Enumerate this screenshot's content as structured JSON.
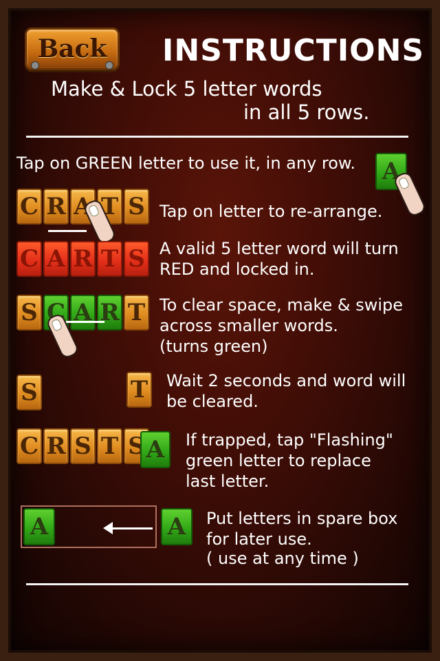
{
  "header": {
    "back_label": "Back",
    "title": "INSTRUCTIONS",
    "subtitle_line1": "Make & Lock 5 letter words",
    "subtitle_line2": "in all 5 rows."
  },
  "steps": [
    {
      "line1": "Tap on GREEN letter to use it, in any row.",
      "tile": "A"
    },
    {
      "line1": "Tap on letter to re-arrange.",
      "tiles": [
        "C",
        "R",
        "A",
        "T",
        "S"
      ]
    },
    {
      "line1": "A valid 5 letter word will turn",
      "line2": "RED and locked in.",
      "tiles": [
        "C",
        "A",
        "R",
        "T",
        "S"
      ]
    },
    {
      "line1": "To clear space, make & swipe",
      "line2": " across smaller words.",
      "line3": " (turns green)",
      "tiles": [
        "S",
        "C",
        "A",
        "R",
        "T"
      ]
    },
    {
      "line1": "Wait 2 seconds and word will",
      "line2": "be cleared.",
      "tiles": [
        "S",
        "T"
      ]
    },
    {
      "line1": "If trapped, tap \"Flashing\"",
      "line2": "green letter to replace",
      "line3": "last letter.",
      "tiles": [
        "C",
        "R",
        "S",
        "T",
        "S",
        "A"
      ]
    },
    {
      "line1": "Put letters in spare box",
      "line2": "for later use.",
      "line3": "( use at any time )",
      "tiles": [
        "A",
        "A"
      ]
    }
  ],
  "colors": {
    "orange_tile": "#e08c20",
    "red_tile": "#e4301a",
    "green_tile": "#32a818",
    "background": "#3b0c06"
  }
}
